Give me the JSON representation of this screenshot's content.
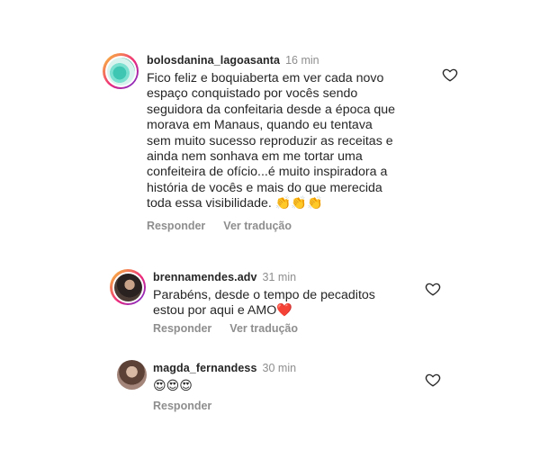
{
  "comments": [
    {
      "username": "bolosdanina_lagoasanta",
      "time": "16 min",
      "text": "Fico feliz e boquiaberta em ver cada novo\nespaço conquistado por vocês sendo\nseguidora da confeitaria desde a época que\nmorava em Manaus, quando eu  tentava\nsem muito sucesso reproduzir as receitas e\nainda nem sonhava em me tortar uma\nconfeiteira de ofício...é muito inspiradora a\nhistória de vocês e mais do que merecida\ntoda essa visibilidade. 👏👏👏",
      "reply_label": "Responder",
      "translate_label": "Ver tradução"
    },
    {
      "username": "brennamendes.adv",
      "time": "31 min",
      "text": "Parabéns, desde o tempo de pecaditos\nestou por aqui e AMO❤️",
      "reply_label": "Responder",
      "translate_label": "Ver tradução"
    },
    {
      "username": "magda_fernandess",
      "time": "30 min",
      "text": "😍😍😍",
      "reply_label": "Responder"
    }
  ],
  "icons": {
    "like": "heart-outline-icon"
  },
  "colors": {
    "username": "#262626",
    "meta": "#8e8e8e",
    "story_ring_start": "#f9ce34",
    "story_ring_end": "#6228d7",
    "heart_red": "#e0245e"
  }
}
